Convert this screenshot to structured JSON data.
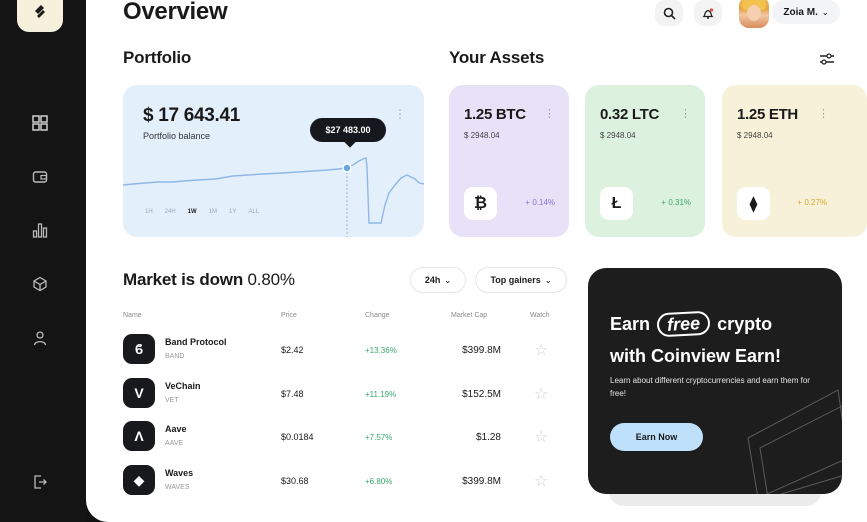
{
  "header": {
    "title": "Overview",
    "user_name": "Zoia M."
  },
  "portfolio": {
    "section_title": "Portfolio",
    "balance": "$ 17 643.41",
    "balance_label": "Portfolio balance",
    "tooltip": "$27 483.00",
    "ranges": [
      "1H",
      "24H",
      "1W",
      "1M",
      "1Y",
      "ALL"
    ],
    "active_range": "1W"
  },
  "assets": {
    "section_title": "Your Assets",
    "items": [
      {
        "amount": "1.25 BTC",
        "usd": "$ 2948.04",
        "change": "+ 0.14%",
        "glyph": "₿",
        "color": "#e7e2f7",
        "change_color": "#8a70d6"
      },
      {
        "amount": "0.32 LTC",
        "usd": "$ 2948.04",
        "change": "+ 0.31%",
        "glyph": "Ł",
        "color": "#dcf2df",
        "change_color": "#3aa86b"
      },
      {
        "amount": "1.25 ETH",
        "usd": "$ 2948.04",
        "change": "+ 0.27%",
        "glyph": "⧫",
        "color": "#f8f1da",
        "change_color": "#d6a72a"
      }
    ]
  },
  "market": {
    "title_bold": "Market is down",
    "title_value": "0.80%",
    "filter_period": "24h",
    "filter_sort": "Top gainers",
    "columns": {
      "name": "Name",
      "price": "Price",
      "change": "Change",
      "cap": "Market Cap",
      "watch": "Watch"
    },
    "rows": [
      {
        "name": "Band Protocol",
        "symbol": "BAND",
        "price": "$2.42",
        "change": "+13.36%",
        "cap": "$399.8M",
        "glyph": "ϐ"
      },
      {
        "name": "VeChain",
        "symbol": "VET",
        "price": "$7.48",
        "change": "+11.19%",
        "cap": "$152.5M",
        "glyph": "V"
      },
      {
        "name": "Aave",
        "symbol": "AAVE",
        "price": "$0.0184",
        "change": "+7.57%",
        "cap": "$1.28",
        "glyph": "Λ"
      },
      {
        "name": "Waves",
        "symbol": "WAVES",
        "price": "$30.68",
        "change": "+6.80%",
        "cap": "$399.8M",
        "glyph": "◆"
      }
    ]
  },
  "promo": {
    "earn": "Earn",
    "free": "free",
    "crypto": "crypto",
    "line2": "with Coinview Earn!",
    "description": "Learn about different cryptocurrencies and earn them for free!",
    "button": "Earn Now"
  }
}
